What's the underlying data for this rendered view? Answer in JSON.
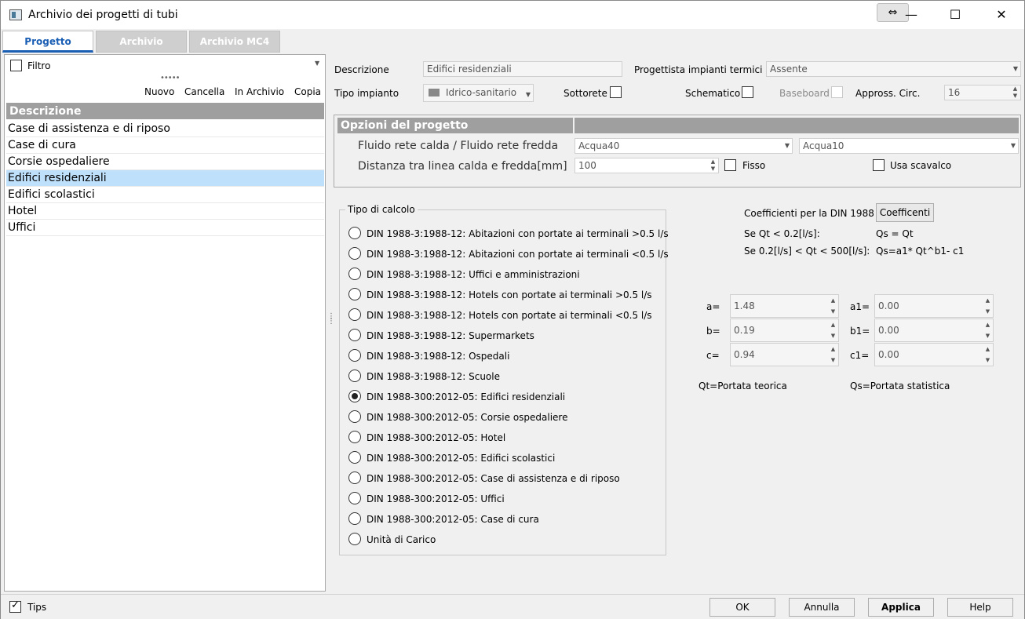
{
  "window": {
    "title": "Archivio dei progetti di tubi",
    "swap_glyph": "⇔",
    "minimize": "—",
    "maximize": "☐",
    "close": "✕"
  },
  "tabs": [
    {
      "label": "Progetto"
    },
    {
      "label": "Archivio"
    },
    {
      "label": "Archivio MC4"
    }
  ],
  "left": {
    "filter_label": "Filtro",
    "actions": {
      "new": "Nuovo",
      "delete": "Cancella",
      "to_archive": "In Archivio",
      "copy": "Copia"
    },
    "column_header": "Descrizione",
    "items": [
      "Case di assistenza e di riposo",
      "Case di cura",
      "Corsie ospedaliere",
      "Edifici residenziali",
      "Edifici scolastici",
      "Hotel",
      "Uffici"
    ],
    "selected_index": 3
  },
  "form": {
    "descrizione_label": "Descrizione",
    "descrizione_value": "Edifici residenziali",
    "progettista_label": "Progettista impianti termici",
    "progettista_value": "Assente",
    "tipo_impianto_label": "Tipo impianto",
    "tipo_impianto_value": "Idrico-sanitario",
    "sottorete_label": "Sottorete",
    "schematico_label": "Schematico",
    "baseboard_label": "Baseboard",
    "appross_label": "Appross. Circ.",
    "appross_value": "16"
  },
  "options": {
    "header": "Opzioni del progetto",
    "fluido_label": "Fluido rete calda / Fluido rete fredda",
    "fluido_caldo": "Acqua40",
    "fluido_freddo": "Acqua10",
    "distanza_label": "Distanza tra linea calda e fredda[mm]",
    "distanza_value": "100",
    "fisso_label": "Fisso",
    "scavalco_label": "Usa scavalco"
  },
  "calc": {
    "group_title": "Tipo di calcolo",
    "options": [
      "DIN 1988-3:1988-12: Abitazioni con portate ai terminali >0.5 l/s",
      "DIN 1988-3:1988-12: Abitazioni con portate ai terminali <0.5 l/s",
      "DIN 1988-3:1988-12: Uffici e amministrazioni",
      "DIN 1988-3:1988-12: Hotels con portate ai terminali >0.5 l/s",
      "DIN 1988-3:1988-12: Hotels con portate ai terminali <0.5 l/s",
      "DIN 1988-3:1988-12: Supermarkets",
      "DIN 1988-3:1988-12: Ospedali",
      "DIN 1988-3:1988-12: Scuole",
      "DIN 1988-300:2012-05: Edifici residenziali",
      "DIN 1988-300:2012-05: Corsie ospedaliere",
      "DIN 1988-300:2012-05: Hotel",
      "DIN 1988-300:2012-05: Edifici scolastici",
      "DIN 1988-300:2012-05: Case di assistenza e di riposo",
      "DIN 1988-300:2012-05: Uffici",
      "DIN 1988-300:2012-05: Case di cura",
      "Unità di Carico"
    ],
    "selected_index": 8
  },
  "coeff": {
    "title": "Coefficienti per la DIN 1988",
    "button": "Coefficenti",
    "rule1_cond": "Se Qt < 0.2[l/s]:",
    "rule1_eq": "Qs = Qt",
    "rule2_cond": "Se 0.2[l/s] < Qt < 500[l/s]:",
    "rule2_eq": "Qs=a1* Qt^b1- c1",
    "a_label": "a=",
    "a_value": "1.48",
    "b_label": "b=",
    "b_value": "0.19",
    "c_label": "c=",
    "c_value": "0.94",
    "a1_label": "a1=",
    "a1_value": "0.00",
    "b1_label": "b1=",
    "b1_value": "0.00",
    "c1_label": "c1=",
    "c1_value": "0.00",
    "qt_note": "Qt=Portata teorica",
    "qs_note": "Qs=Portata statistica"
  },
  "footer": {
    "tips_label": "Tips",
    "ok": "OK",
    "cancel": "Annulla",
    "apply": "Applica",
    "help": "Help"
  }
}
